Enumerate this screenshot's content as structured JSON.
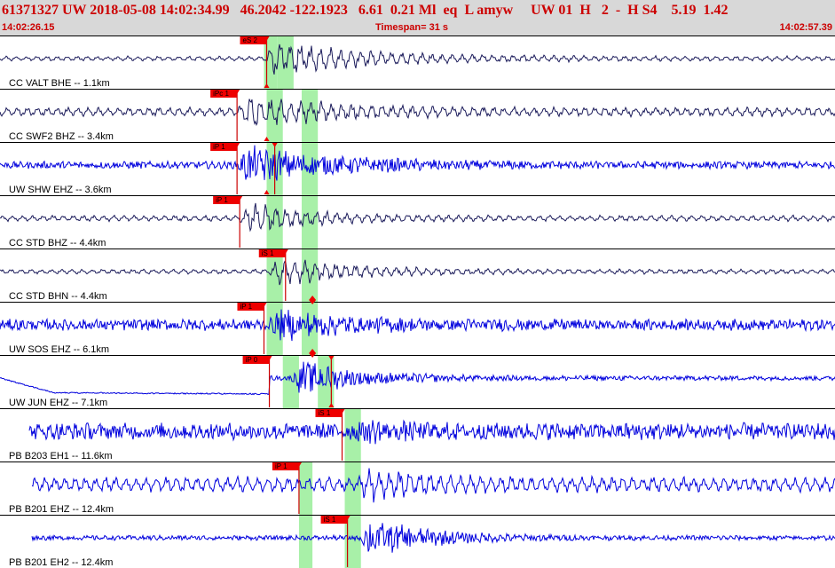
{
  "header": {
    "event_line": "61371327 UW 2018-05-08 14:02:34.99   46.2042 -122.1923   6.61  0.21 Ml  eq  L amyw     UW 01  H   2  -  H S4    5.19  1.42",
    "start_time": "14:02:26.15",
    "timespan": "Timespan=  31 s",
    "end_time": "14:02:57.39"
  },
  "colors": {
    "header_bg": "#d8d8d8",
    "header_text": "#cc0000",
    "trace_dark": "#1a1a5a",
    "trace_blue": "#0000dd",
    "pick_window": "#a8f0a8",
    "pick_flag": "#ee0000",
    "pick_line": "#cc0000"
  },
  "chart_data": {
    "type": "seismogram",
    "time_start": "14:02:26.15",
    "time_end": "14:02:57.39",
    "timespan_s": 31,
    "channels": [
      {
        "label": "CC VALT BHE -- 1.1km",
        "color": "dark",
        "style": "smooth",
        "amp": 0.12,
        "trace_start": 0.0,
        "trace_end": 31.0,
        "onset": 9.8,
        "burst_amp": 0.95,
        "burst_dur": 8.0,
        "picks": [
          {
            "label": "eS 2",
            "t": 9.9,
            "flag": "top"
          },
          {
            "t": 9.9,
            "flag": "bottom"
          }
        ]
      },
      {
        "label": "CC SWF2 BHZ -- 3.4km",
        "color": "dark",
        "style": "smooth",
        "amp": 0.22,
        "trace_start": 0.0,
        "trace_end": 31.0,
        "onset": 8.8,
        "burst_amp": 0.9,
        "burst_dur": 7.0,
        "picks": [
          {
            "label": "iPc 1",
            "t": 8.8,
            "flag": "top"
          },
          {
            "t": 9.9,
            "flag": "bottom"
          }
        ]
      },
      {
        "label": "UW SHW EHZ -- 3.6km",
        "color": "blue",
        "style": "noisy",
        "amp": 0.18,
        "trace_start": 0.0,
        "trace_end": 31.0,
        "onset": 8.8,
        "burst_amp": 1.0,
        "burst_dur": 7.5,
        "picks": [
          {
            "label": "iP 1",
            "t": 8.8,
            "flag": "top"
          },
          {
            "t": 10.2,
            "flag": "top"
          },
          {
            "t": 9.9,
            "flag": "bottom"
          }
        ]
      },
      {
        "label": "CC STD BHZ -- 4.4km",
        "color": "dark",
        "style": "smooth",
        "amp": 0.15,
        "trace_start": 0.0,
        "trace_end": 31.0,
        "onset": 8.9,
        "burst_amp": 0.85,
        "burst_dur": 5.0,
        "picks": [
          {
            "label": "iP 1",
            "t": 8.9,
            "flag": "top"
          }
        ]
      },
      {
        "label": "CC STD BHN -- 4.4km",
        "color": "dark",
        "style": "smooth",
        "amp": 0.12,
        "trace_start": 0.0,
        "trace_end": 31.0,
        "onset": 10.0,
        "burst_amp": 0.8,
        "burst_dur": 6.0,
        "picks": [
          {
            "label": "iS 1",
            "t": 10.6,
            "flag": "top"
          },
          {
            "t": 11.6,
            "flag": "diamond"
          }
        ]
      },
      {
        "label": "UW SOS EHZ -- 6.1km",
        "color": "blue",
        "style": "noisy",
        "amp": 0.28,
        "trace_start": 0.0,
        "trace_end": 31.3,
        "onset": 10.0,
        "burst_amp": 0.85,
        "burst_dur": 6.0,
        "picks": [
          {
            "label": "iP 1",
            "t": 9.8,
            "flag": "top"
          },
          {
            "t": 11.6,
            "flag": "diamond"
          }
        ]
      },
      {
        "label": "UW JUN EHZ -- 7.1km",
        "color": "blue",
        "style": "noisy",
        "amp": 0.12,
        "trace_start": 0.0,
        "trace_end": 31.4,
        "onset": 10.8,
        "burst_amp": 0.9,
        "burst_dur": 5.0,
        "picks": [
          {
            "label": "iP 0",
            "t": 10.0,
            "flag": "top"
          },
          {
            "t": 12.3,
            "flag": "top"
          },
          {
            "t": 12.3,
            "flag": "bottom"
          }
        ]
      },
      {
        "label": "PB B203 EH1 -- 11.6km",
        "color": "blue",
        "style": "noisy",
        "amp": 0.42,
        "trace_start": 1.1,
        "trace_end": 31.7,
        "onset": 13.0,
        "burst_amp": 0.7,
        "burst_dur": 4.0,
        "picks": [
          {
            "label": "iS 1",
            "t": 12.7,
            "flag": "top"
          }
        ]
      },
      {
        "label": "PB B201 EHZ -- 12.4km",
        "color": "blue",
        "style": "smooth",
        "amp": 0.38,
        "trace_start": 1.2,
        "trace_end": 31.8,
        "onset": 13.3,
        "burst_amp": 0.95,
        "burst_dur": 5.0,
        "picks": [
          {
            "label": "iP 1",
            "t": 11.1,
            "flag": "top"
          }
        ]
      },
      {
        "label": "PB B201 EH2 -- 12.4km",
        "color": "blue",
        "style": "noisy",
        "amp": 0.12,
        "trace_start": 1.2,
        "trace_end": 31.8,
        "onset": 13.3,
        "burst_amp": 1.0,
        "burst_dur": 5.0,
        "picks": [
          {
            "label": "iS 1",
            "t": 12.9,
            "flag": "top"
          }
        ]
      }
    ],
    "green_windows": [
      {
        "start": 9.8,
        "end": 10.3,
        "row_start": 0,
        "row_end": 1
      },
      {
        "start": 10.3,
        "end": 10.9,
        "row_start": 0,
        "row_end": 1
      },
      {
        "start": 9.9,
        "end": 10.5,
        "row_start": 1,
        "row_end": 6
      },
      {
        "start": 11.2,
        "end": 11.8,
        "row_start": 1,
        "row_end": 6
      },
      {
        "start": 10.5,
        "end": 11.1,
        "row_start": 6,
        "row_end": 7
      },
      {
        "start": 11.8,
        "end": 12.4,
        "row_start": 6,
        "row_end": 7
      },
      {
        "start": 12.8,
        "end": 13.4,
        "row_start": 7,
        "row_end": 10
      },
      {
        "start": 11.1,
        "end": 11.6,
        "row_start": 8,
        "row_end": 10
      }
    ]
  }
}
